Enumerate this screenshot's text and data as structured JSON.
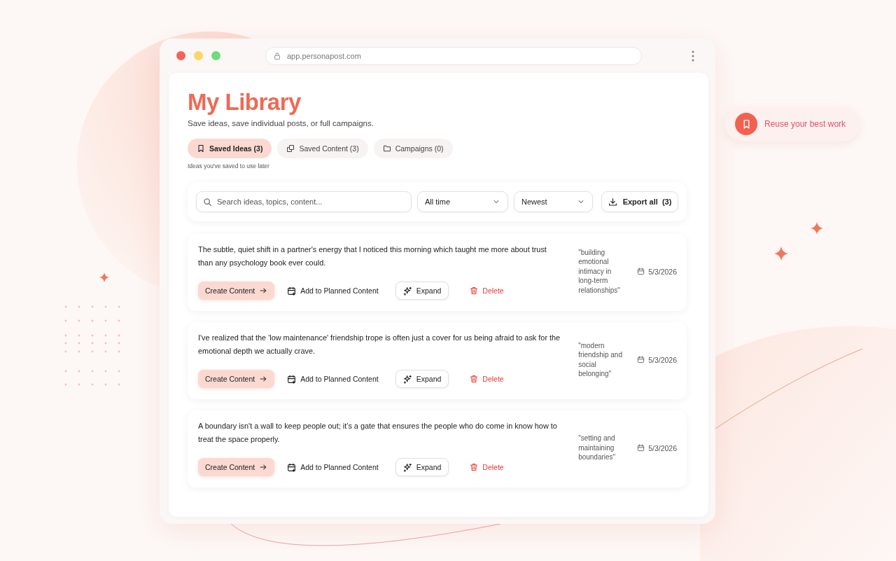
{
  "browser": {
    "url": "app.personapost.com"
  },
  "page": {
    "title": "My Library",
    "subtitle": "Save ideas, save individual posts, or full campaigns."
  },
  "tabs": [
    {
      "kind": "ideas",
      "label": "Saved Ideas (3)",
      "selected": true
    },
    {
      "kind": "content",
      "label": "Saved Content (3)",
      "selected": false
    },
    {
      "kind": "campaigns",
      "label": "Campaigns (0)",
      "selected": false
    }
  ],
  "tab_hint": "Ideas you've saved to use later",
  "filters": {
    "search": {
      "placeholder": "Search ideas, topics, content..."
    },
    "period": "All time",
    "sort": "Newest",
    "export": "Export all  (3)"
  },
  "ideas": [
    {
      "text": "The subtle, quiet shift in a partner's energy that I noticed this morning which taught me more about trust than any psychology book ever could.",
      "topic": "\"building emotional intimacy in long-term relationships\"",
      "date": "5/3/2026",
      "actions": [
        {
          "kind": "create",
          "label": "Create Content"
        },
        {
          "kind": "plan",
          "label": "Add to Planned Content"
        },
        {
          "kind": "expand",
          "label": "Expand"
        },
        {
          "kind": "delete",
          "label": "Delete"
        }
      ]
    },
    {
      "text": "I've realized that the 'low maintenance' friendship trope is often just a cover for us being afraid to ask for the emotional depth we actually crave.",
      "topic": "\"modern friendship and social belonging\"",
      "date": "5/3/2026",
      "actions": [
        {
          "kind": "create",
          "label": "Create Content"
        },
        {
          "kind": "plan",
          "label": "Add to Planned Content"
        },
        {
          "kind": "expand",
          "label": "Expand"
        },
        {
          "kind": "delete",
          "label": "Delete"
        }
      ]
    },
    {
      "text": "A boundary isn't a wall to keep people out; it’s a gate that ensures the people who do come in know how to treat the space properly.",
      "topic": "\"setting and maintaining boundaries\"",
      "date": "5/3/2026",
      "actions": [
        {
          "kind": "create",
          "label": "Create Content"
        },
        {
          "kind": "plan",
          "label": "Add to Planned Content"
        },
        {
          "kind": "expand",
          "label": "Expand"
        },
        {
          "kind": "delete",
          "label": "Delete"
        }
      ]
    }
  ],
  "callout": {
    "label": "Reuse your best work"
  }
}
